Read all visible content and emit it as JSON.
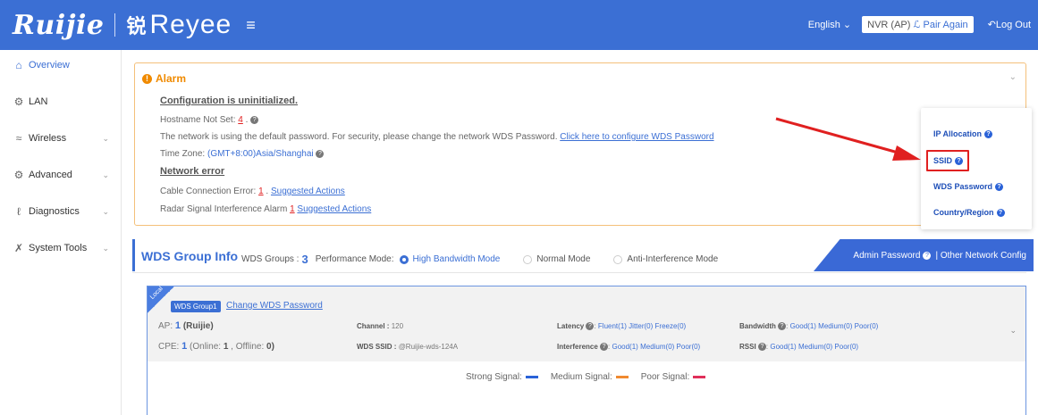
{
  "header": {
    "brand": "Ruijie",
    "sub_brand_mark": "锐",
    "sub_brand": "Reyee",
    "menu_icon": "menu-icon",
    "language": "English",
    "device_label": "NVR (AP)",
    "pair_again": "Pair Again",
    "logout": "Log Out",
    "colors": {
      "bar": "#3b6fd4"
    }
  },
  "sidebar": {
    "items": [
      {
        "label": "Overview",
        "icon": "home-icon",
        "active": true
      },
      {
        "label": "LAN",
        "icon": "gear-icon"
      },
      {
        "label": "Wireless",
        "icon": "wifi-icon"
      },
      {
        "label": "Advanced",
        "icon": "gear-icon"
      },
      {
        "label": "Diagnostics",
        "icon": "stethoscope-icon"
      },
      {
        "label": "System Tools",
        "icon": "tools-icon"
      }
    ]
  },
  "alarm": {
    "title": "Alarm",
    "config_heading": "Configuration is uninitialized.",
    "hostname_label": "Hostname Not Set:",
    "hostname_count": "4",
    "password_text": "The network is using the default password. For security, please change the network WDS Password.",
    "password_link": "Click here to configure WDS Password",
    "timezone_label": "Time Zone:",
    "timezone_value": "(GMT+8:00)Asia/Shanghai",
    "network_heading": "Network error",
    "cable_label": "Cable Connection Error:",
    "cable_count": "1",
    "cable_link": "Suggested Actions",
    "radar_label": "Radar Signal Interference Alarm",
    "radar_count": "1",
    "radar_link": "Suggested Actions"
  },
  "popup": {
    "items": [
      "IP Allocation",
      "SSID",
      "WDS Password",
      "Country/Region"
    ],
    "highlighted": "SSID",
    "highlight_color": "#e02020"
  },
  "wds": {
    "title": "WDS Group Info",
    "groups_label": "WDS Groups :",
    "groups_count": "3",
    "mode_label": "Performance Mode:",
    "modes": [
      "High Bandwidth Mode",
      "Normal Mode",
      "Anti-Interference Mode"
    ],
    "selected_mode": "High Bandwidth Mode",
    "admin_password": "Admin Password",
    "other_config": "Other Network Config"
  },
  "group": {
    "ribbon": "Local",
    "badge": "WDS Group1",
    "change_link": "Change WDS Password",
    "ap_label": "AP:",
    "ap_count": "1",
    "ap_name": "(Ruijie)",
    "cpe_label": "CPE:",
    "cpe_count": "1",
    "cpe_online_label": "(Online:",
    "cpe_online": "1",
    "cpe_offline_label": ", Offline:",
    "cpe_offline": "0)",
    "channel_label": "Channel :",
    "channel_value": "120",
    "ssid_label": "WDS SSID :",
    "ssid_value": "@Ruijie-wds-124A",
    "latency_label": "Latency",
    "latency_values": [
      "Fluent(1)",
      "Jitter(0)",
      "Freeze(0)"
    ],
    "interference_label": "Interference",
    "interference_values": [
      "Good(1)",
      "Medium(0)",
      "Poor(0)"
    ],
    "bandwidth_label": "Bandwidth",
    "bandwidth_values": [
      "Good(1)",
      "Medium(0)",
      "Poor(0)"
    ],
    "rssi_label": "RSSI",
    "rssi_values": [
      "Good(1)",
      "Medium(0)",
      "Poor(0)"
    ]
  },
  "legend": {
    "strong": "Strong Signal:",
    "medium": "Medium Signal:",
    "poor": "Poor Signal:",
    "colors": {
      "strong": "#2a62d8",
      "medium": "#f08a30",
      "poor": "#e0305a"
    }
  }
}
